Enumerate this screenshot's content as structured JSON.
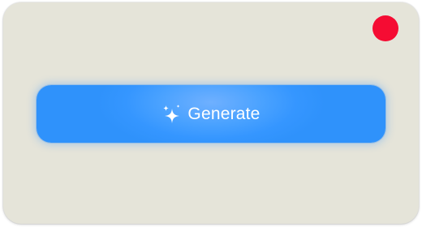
{
  "button": {
    "label": "Generate",
    "icon": "sparkle-icon"
  },
  "indicator": {
    "icon": "record-dot",
    "color": "#f50c33"
  },
  "colors": {
    "card_background": "#e5e4d9",
    "button_background": "#3596ff",
    "button_text": "#ffffff"
  }
}
